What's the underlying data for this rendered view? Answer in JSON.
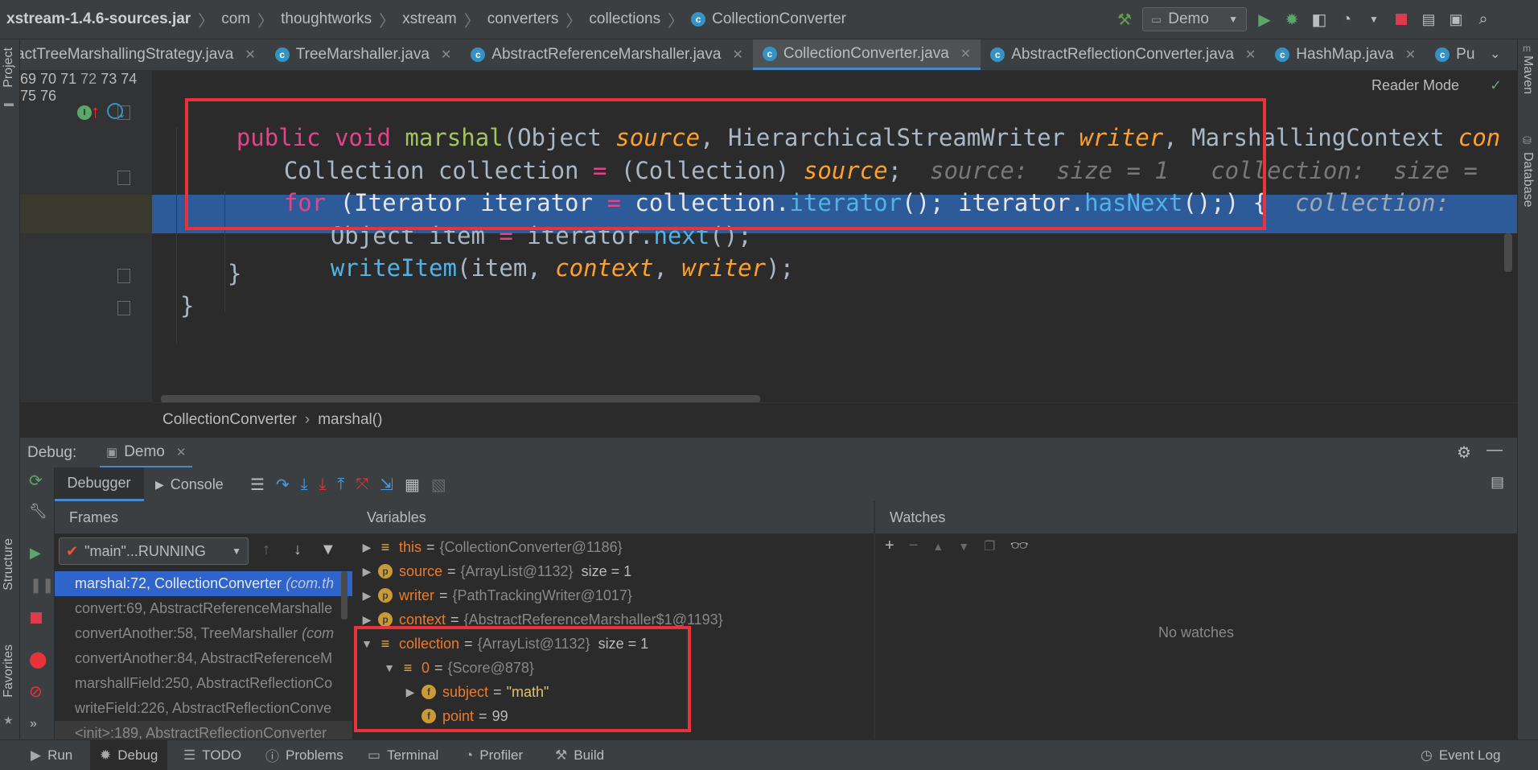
{
  "navbar": {
    "crumbs": [
      "xstream-1.4.6-sources.jar",
      "com",
      "thoughtworks",
      "xstream",
      "converters",
      "collections",
      "CollectionConverter"
    ],
    "run_config": "Demo"
  },
  "tabs": [
    {
      "label": "actTreeMarshallingStrategy.java",
      "active": false
    },
    {
      "label": "TreeMarshaller.java",
      "active": false
    },
    {
      "label": "AbstractReferenceMarshaller.java",
      "active": false
    },
    {
      "label": "CollectionConverter.java",
      "active": true
    },
    {
      "label": "AbstractReflectionConverter.java",
      "active": false
    },
    {
      "label": "HashMap.java",
      "active": false
    },
    {
      "label": "Pu",
      "active": false
    }
  ],
  "side_tools": {
    "left": [
      "Project",
      "Structure",
      "Favorites"
    ],
    "right": [
      "Maven",
      "Database"
    ]
  },
  "editor": {
    "reader_mode": "Reader Mode",
    "line_numbers": [
      "69",
      "70",
      "71",
      "72",
      "73",
      "74",
      "75",
      "76"
    ],
    "lines": {
      "l70": {
        "kw1": "public",
        "kw2": "void",
        "method": "marshal",
        "p1": "(Object ",
        "a1": "source",
        "p2": ", HierarchicalStreamWriter ",
        "a2": "writer",
        "p3": ", MarshallingContext ",
        "a3": "con"
      },
      "l71": {
        "t1": "Collection collection ",
        "eq": "=",
        "t2": " (Collection) ",
        "a1": "source",
        "t3": ";",
        "hint": "source:  size = 1   collection:  size ="
      },
      "l72": {
        "kw": "for",
        "t1": " (Iterator iterator ",
        "eq": "=",
        "t2": " collection.",
        "m1": "iterator",
        "t3": "(); iterator.",
        "m2": "hasNext",
        "t4": "();) {",
        "hint": "collection:"
      },
      "l73": {
        "t1": "Object item ",
        "eq": "=",
        "t2": " iterator.",
        "m1": "next",
        "t3": "();"
      },
      "l74": {
        "m1": "writeItem",
        "t1": "(item, ",
        "a1": "context",
        "t2": ", ",
        "a2": "writer",
        "t3": ");"
      },
      "l75": {
        "t1": "}"
      },
      "l76": {
        "t1": "}"
      }
    },
    "breadcrumb": [
      "CollectionConverter",
      "marshal()"
    ]
  },
  "debug": {
    "label": "Debug:",
    "session_tab": "Demo",
    "tabs": [
      "Debugger",
      "Console"
    ],
    "frames": {
      "title": "Frames",
      "thread": "\"main\"...RUNNING",
      "rows": [
        {
          "method": "marshal:72, CollectionConverter",
          "pkg": "(com.th",
          "sel": true
        },
        {
          "method": "convert:69, AbstractReferenceMarshalle",
          "pkg": "",
          "sel": false
        },
        {
          "method": "convertAnother:58, TreeMarshaller",
          "pkg": "(com",
          "sel": false
        },
        {
          "method": "convertAnother:84, AbstractReferenceM",
          "pkg": "",
          "sel": false
        },
        {
          "method": "marshallField:250, AbstractReflectionCo",
          "pkg": "",
          "sel": false
        },
        {
          "method": "writeField:226, AbstractReflectionConve",
          "pkg": "",
          "sel": false
        },
        {
          "method": "<init>:189, AbstractReflectionConverter",
          "pkg": "",
          "sel": false
        }
      ]
    },
    "variables": {
      "title": "Variables",
      "rows": [
        {
          "name": "this",
          "value": "{CollectionConverter@1186}",
          "extra": ""
        },
        {
          "name": "source",
          "value": "{ArrayList@1132}",
          "extra": "size = 1"
        },
        {
          "name": "writer",
          "value": "{PathTrackingWriter@1017}",
          "extra": ""
        },
        {
          "name": "context",
          "value": "{AbstractReferenceMarshaller$1@1193}",
          "extra": ""
        },
        {
          "name": "collection",
          "value": "{ArrayList@1132}",
          "extra": "size = 1"
        },
        {
          "name": "0",
          "value": "{Score@878}",
          "extra": ""
        },
        {
          "name": "subject",
          "value": "\"math\"",
          "extra": ""
        },
        {
          "name": "point",
          "value": "99",
          "extra": ""
        }
      ]
    },
    "watches": {
      "title": "Watches",
      "empty": "No watches"
    }
  },
  "statusbar": {
    "items": [
      "Run",
      "Debug",
      "TODO",
      "Problems",
      "Terminal",
      "Profiler",
      "Build"
    ],
    "event_log": "Event Log"
  },
  "colors": {
    "highlight_box": "#E8333A",
    "exec_line": "#2D5B9A",
    "selected_frame": "#2F65CA"
  }
}
